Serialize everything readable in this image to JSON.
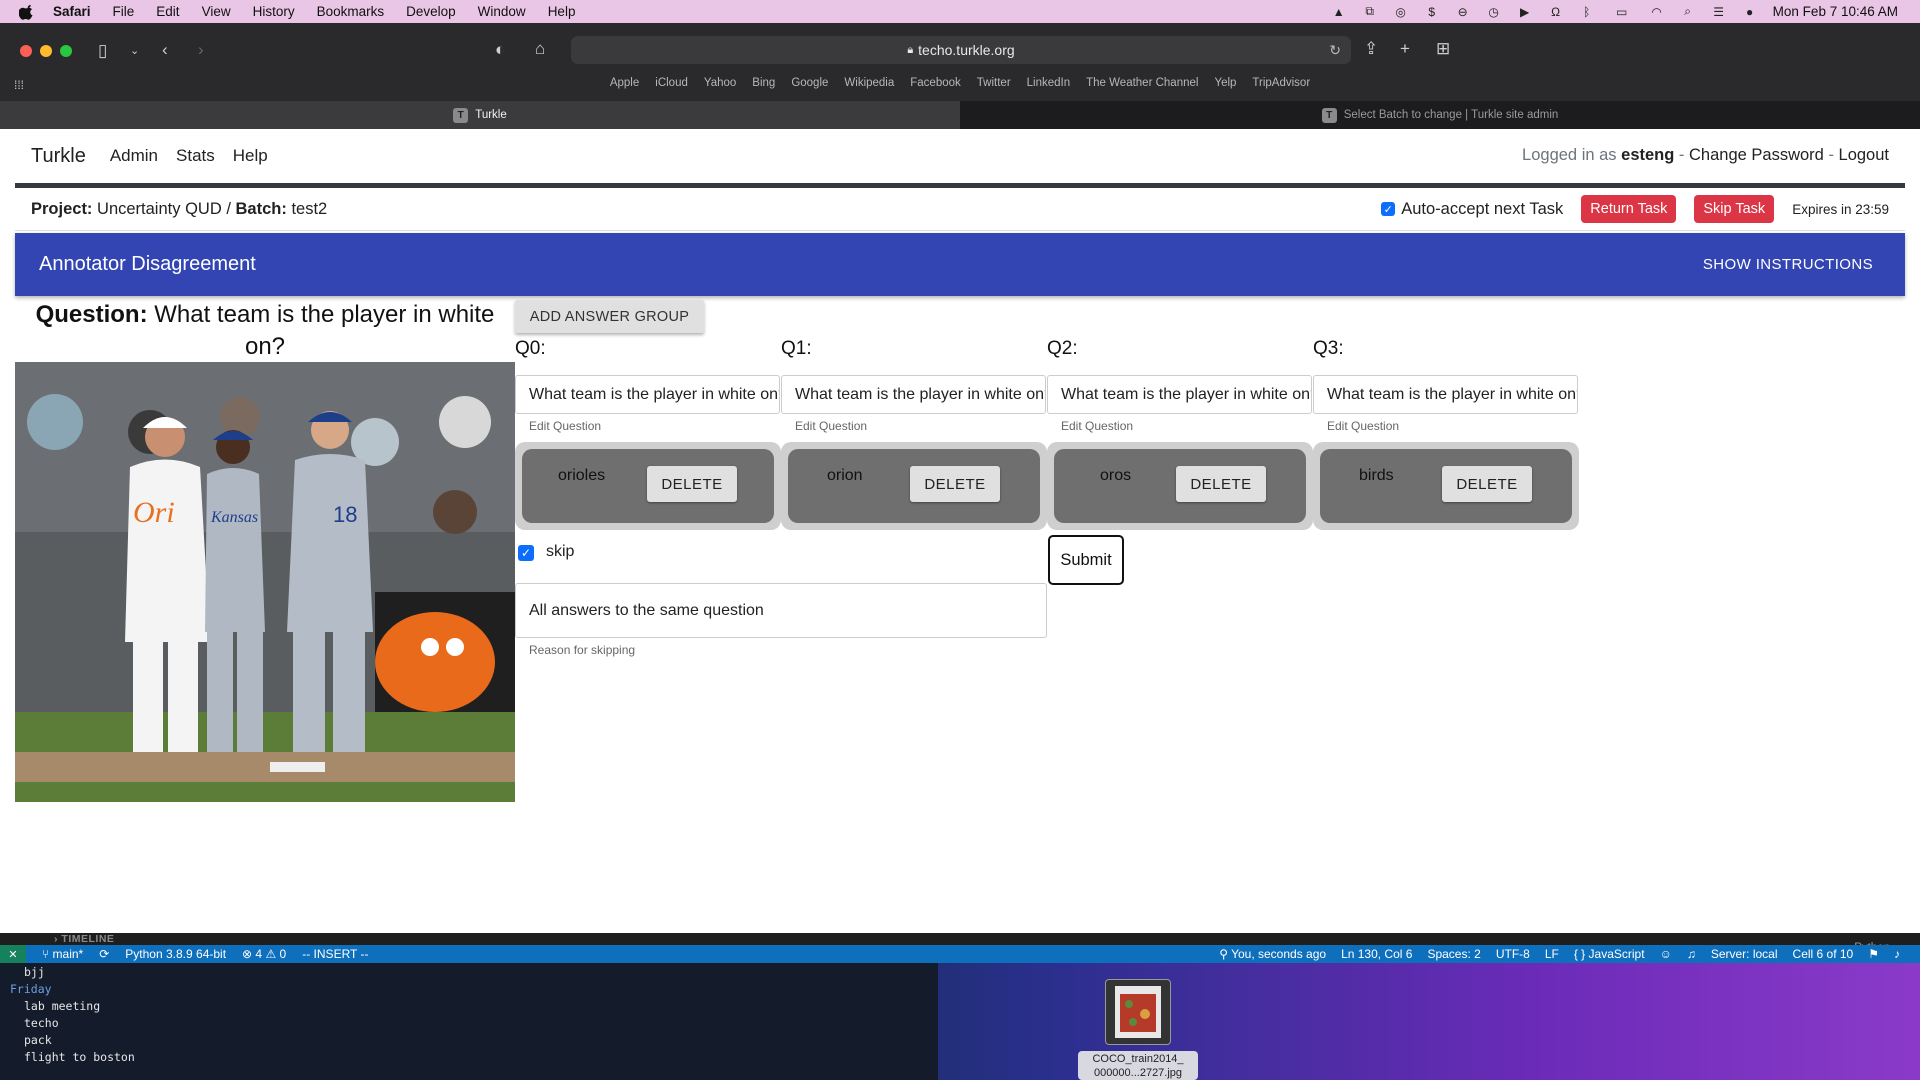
{
  "menubar": {
    "app": "Safari",
    "items": [
      "File",
      "Edit",
      "View",
      "History",
      "Bookmarks",
      "Develop",
      "Window",
      "Help"
    ],
    "datetime": "Mon Feb 7  10:46 AM"
  },
  "browser": {
    "url": "techo.turkle.org",
    "favorites": [
      "Apple",
      "iCloud",
      "Yahoo",
      "Bing",
      "Google",
      "Wikipedia",
      "Facebook",
      "Twitter",
      "LinkedIn",
      "The Weather Channel",
      "Yelp",
      "TripAdvisor"
    ],
    "tabs": [
      {
        "label": "Turkle",
        "icon_letter": "T"
      },
      {
        "label": "Select Batch to change | Turkle site admin",
        "icon_letter": "T"
      }
    ]
  },
  "nav": {
    "brand": "Turkle",
    "links": [
      "Admin",
      "Stats",
      "Help"
    ],
    "logged_in_prefix": "Logged in as",
    "username": "esteng",
    "change_password": "Change Password",
    "logout": "Logout",
    "sep": "-"
  },
  "project": {
    "project_label": "Project:",
    "project_name": "Uncertainty QUD",
    "slash": "/",
    "batch_label": "Batch:",
    "batch_name": "test2",
    "auto_accept": "Auto-accept next Task",
    "auto_accept_checked": true,
    "return_task": "Return Task",
    "skip_task": "Skip Task",
    "expires": "Expires in 23:59"
  },
  "banner": {
    "title": "Annotator Disagreement",
    "show_instructions": "SHOW INSTRUCTIONS",
    "color": "#3245b3"
  },
  "task": {
    "question_label": "Question:",
    "question_text": "What team is the player in white on?",
    "add_answer_group": "ADD ANSWER GROUP",
    "questions": [
      {
        "label": "Q0:",
        "value": "What team is the player in white on?",
        "help": "Edit Question",
        "answer": "orioles",
        "delete": "DELETE"
      },
      {
        "label": "Q1:",
        "value": "What team is the player in white on?",
        "help": "Edit Question",
        "answer": "orion",
        "delete": "DELETE"
      },
      {
        "label": "Q2:",
        "value": "What team is the player in white on?",
        "help": "Edit Question",
        "answer": "oros",
        "delete": "DELETE"
      },
      {
        "label": "Q3:",
        "value": "What team is the player in white on?",
        "help": "Edit Question",
        "answer": "birds",
        "delete": "DELETE"
      }
    ],
    "skip_label": "skip",
    "skip_checked": true,
    "skip_reason": "All answers to the same question",
    "skip_reason_help": "Reason for skipping",
    "submit": "Submit"
  },
  "vscode": {
    "timeline": "TIMELINE",
    "language_top": "Python",
    "branch": "main*",
    "python": "Python 3.8.9 64-bit",
    "errors": "4",
    "warnings": "0",
    "mode": "-- INSERT --",
    "blame": "You, seconds ago",
    "position": "Ln 130, Col 6",
    "spaces": "Spaces: 2",
    "encoding": "UTF-8",
    "eol": "LF",
    "language": "JavaScript",
    "server": "Server: local",
    "cell": "Cell 6 of 10"
  },
  "terminal": {
    "lines": [
      {
        "text": "bjj",
        "style": "item"
      },
      {
        "text": "Friday",
        "style": "heading"
      },
      {
        "text": "lab meeting",
        "style": "item"
      },
      {
        "text": "techo",
        "style": "item"
      },
      {
        "text": "pack",
        "style": "item"
      },
      {
        "text": "flight to boston",
        "style": "item"
      }
    ]
  },
  "desktop_file": {
    "name_line1": "COCO_train2014_",
    "name_line2": "000000...2727.jpg"
  }
}
